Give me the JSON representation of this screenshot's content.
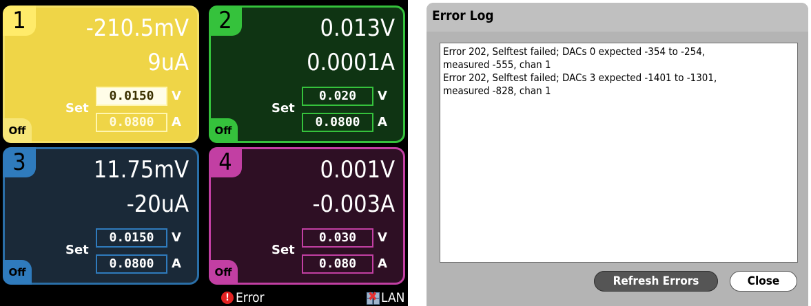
{
  "channels": [
    {
      "number": "1",
      "voltage": "-210.5mV",
      "current": "9uA",
      "set_label": "Set",
      "set_voltage": "0.0150",
      "set_current": "0.0800",
      "unit_v": "V",
      "unit_a": "A",
      "state": "Off",
      "color": "#efd547"
    },
    {
      "number": "2",
      "voltage": "0.013V",
      "current": "0.0001A",
      "set_label": "Set",
      "set_voltage": "0.020",
      "set_current": "0.0800",
      "unit_v": "V",
      "unit_a": "A",
      "state": "Off",
      "color": "#35c23c"
    },
    {
      "number": "3",
      "voltage": "11.75mV",
      "current": "-20uA",
      "set_label": "Set",
      "set_voltage": "0.0150",
      "set_current": "0.0800",
      "unit_v": "V",
      "unit_a": "A",
      "state": "Off",
      "color": "#2f7bbd"
    },
    {
      "number": "4",
      "voltage": "0.001V",
      "current": "-0.003A",
      "set_label": "Set",
      "set_voltage": "0.030",
      "set_current": "0.080",
      "unit_v": "V",
      "unit_a": "A",
      "state": "Off",
      "color": "#c23fa3"
    }
  ],
  "status_bar": {
    "error_icon": "error-alert-icon",
    "error_icon_glyph": "!",
    "error_label": "Error",
    "lan_icon": "lan-disconnected-icon",
    "lan_label": "LAN"
  },
  "error_log_dialog": {
    "title": "Error Log",
    "log_lines": [
      "Error 202, Selftest failed; DACs 0 expected -354 to -254,",
      "measured -555, chan 1",
      "Error 202, Selftest failed; DACs 3 expected -1401 to -1301,",
      "measured -828, chan 1"
    ],
    "refresh_button_label": "Refresh Errors",
    "close_button_label": "Close"
  }
}
